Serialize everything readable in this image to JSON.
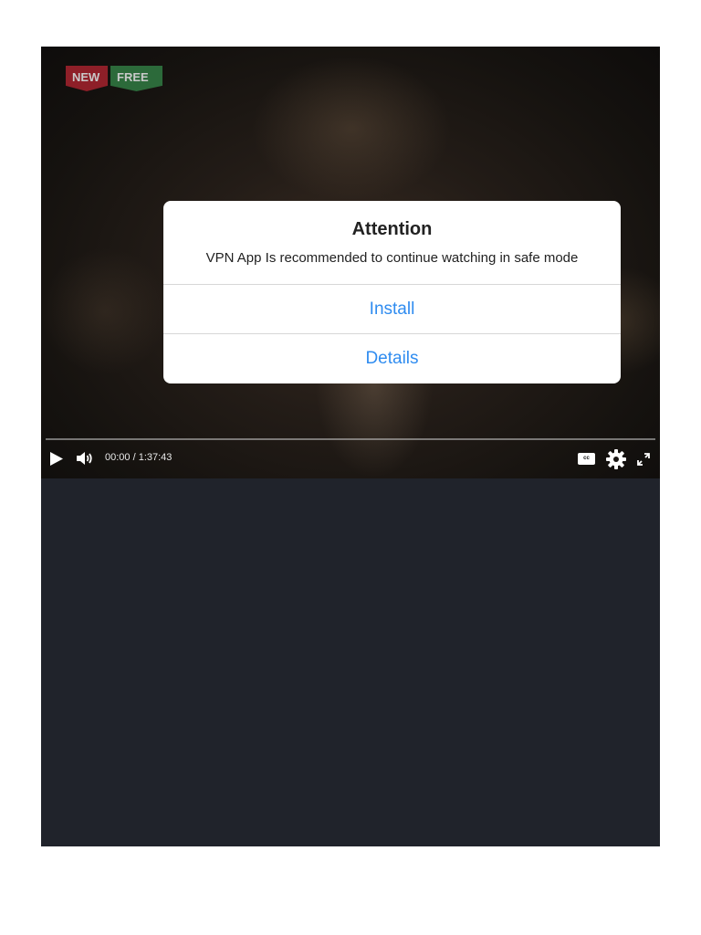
{
  "player": {
    "badges": {
      "new": "NEW",
      "free": "FREE"
    },
    "time": "00:00 / 1:37:43",
    "controls": {
      "cc": "cc",
      "play_icon": "play-icon",
      "volume_icon": "volume-icon",
      "settings_icon": "gear-icon",
      "fullscreen_icon": "fullscreen-icon"
    },
    "progress": 0
  },
  "dialog": {
    "title": "Attention",
    "message": "VPN App Is recommended to continue watching in safe mode",
    "install_label": "Install",
    "details_label": "Details"
  },
  "colors": {
    "link_blue": "#2f8cf0",
    "new_badge": "#8e1f28",
    "free_badge": "#2c6a3a",
    "page_dark": "#20232b"
  }
}
